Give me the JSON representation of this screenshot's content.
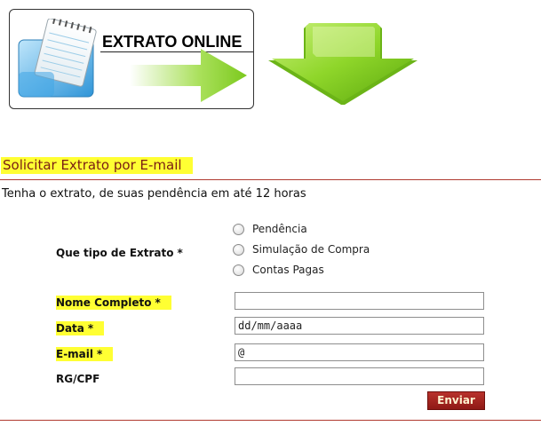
{
  "banner": {
    "title": "EXTRATO ONLINE",
    "icons": [
      "notepad-icon",
      "arrow-right-icon",
      "arrow-down-icon"
    ],
    "colors": {
      "arrow": "#8fd62a",
      "notepad": "#5fb6e8"
    }
  },
  "section": {
    "title": "Solicitar Extrato por E-mail",
    "intro": "Tenha o extrato, de suas pendência em até 12 horas"
  },
  "form": {
    "tipo": {
      "label": "Que tipo de Extrato",
      "required": "*",
      "options": [
        "Pendência",
        "Simulação de Compra",
        "Contas Pagas"
      ]
    },
    "nome": {
      "label": "Nome Completo",
      "required": "*",
      "value": ""
    },
    "data": {
      "label": "Data",
      "required": "*",
      "value": "dd/mm/aaaa"
    },
    "email": {
      "label": "E-mail",
      "required": "*",
      "value": "@"
    },
    "rgcpf": {
      "label": "RG/CPF",
      "value": ""
    },
    "submit_label": "Enviar"
  },
  "colors": {
    "highlight": "#ffff33",
    "accent": "#b03a30",
    "button": "#a3221d"
  }
}
